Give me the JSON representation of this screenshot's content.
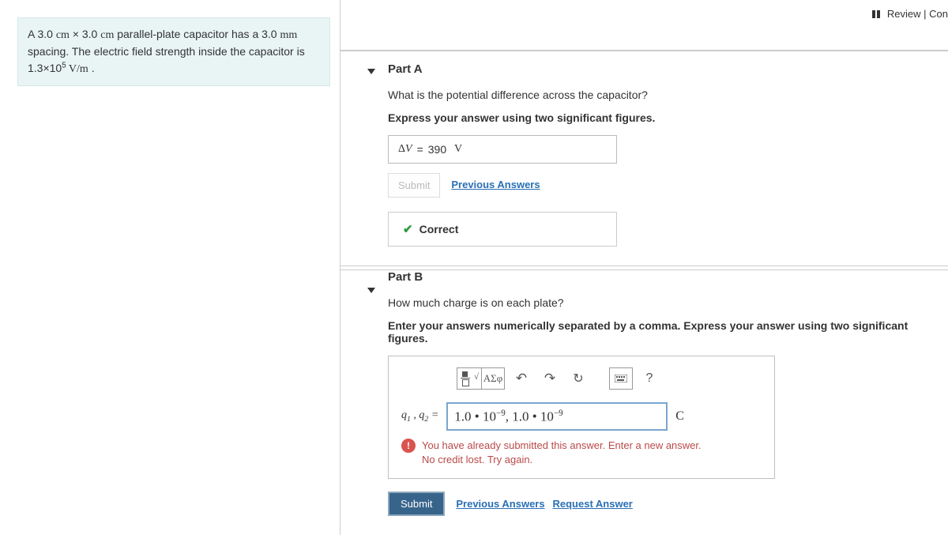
{
  "top": {
    "review": "Review",
    "constants": "Con"
  },
  "problem": {
    "line1_pre": "A 3.0 ",
    "unit_cm": "cm",
    "times": " × 3.0 ",
    "line1_post": " parallel-plate capacitor has a 3.0 ",
    "unit_mm": "mm",
    "line2_pre": "spacing. The electric field strength inside the capacitor is",
    "value": "1.3×10",
    "exp": "5",
    "unit_vm": " V/m",
    "period": " ."
  },
  "partA": {
    "title": "Part A",
    "question": "What is the potential difference across the capacitor?",
    "instruction": "Express your answer using two significant figures.",
    "deltaV": "ΔV",
    "eq": " = ",
    "value": "390",
    "unit": "V",
    "submit": "Submit",
    "prev": "Previous Answers",
    "correct": "Correct"
  },
  "partB": {
    "title": "Part B",
    "question": "How much charge is on each plate?",
    "instruction": "Enter your answers numerically separated by a comma. Express your answer using two significant figures.",
    "var_q1": "q",
    "var_q2": "q",
    "sub1": "1",
    "sub2": "2",
    "comma": " , ",
    "eq": " = ",
    "answer_display": "1.0 • 10⁻⁹, 1.0 • 10⁻⁹",
    "unit": "C",
    "toolbar": {
      "frac_sqrt": "frac-sqrt",
      "greek": "ΑΣφ",
      "undo": "↶",
      "redo": "↷",
      "reset": "↻",
      "keyboard": "⌨",
      "help": "?"
    },
    "warn1": "You have already submitted this answer. Enter a new answer.",
    "warn2": "No credit lost. Try again.",
    "submit": "Submit",
    "prev": "Previous Answers",
    "request": "Request Answer"
  }
}
